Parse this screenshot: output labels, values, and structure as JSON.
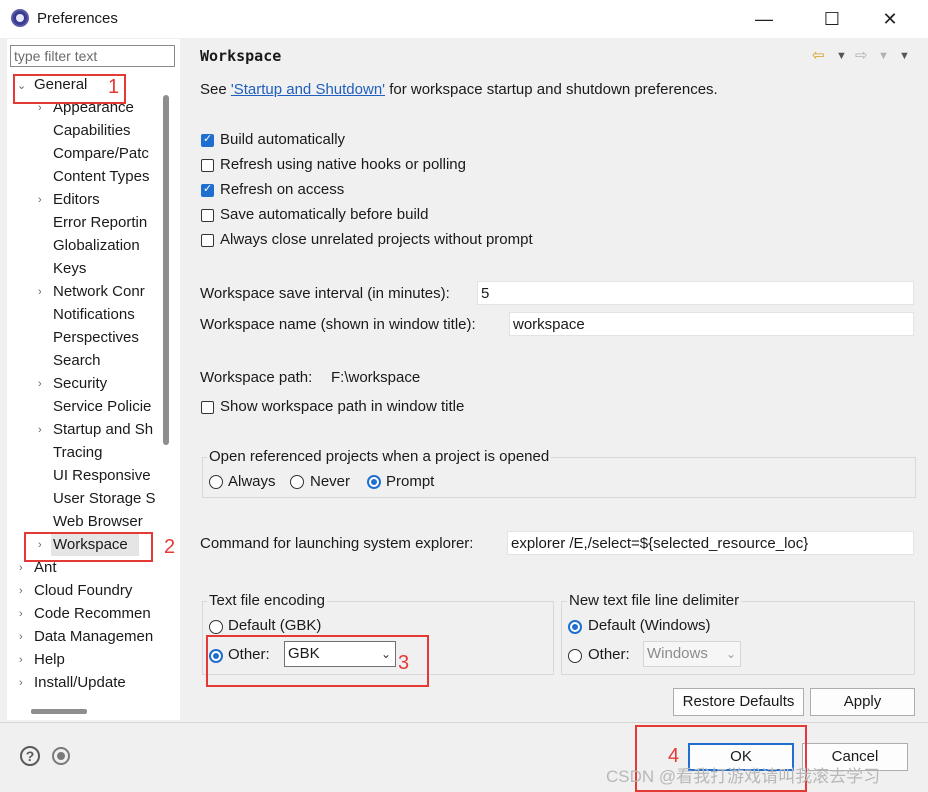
{
  "window": {
    "title": "Preferences",
    "buttons": {
      "minimize": "—",
      "maximize": "☐",
      "close": "✕"
    }
  },
  "filter": {
    "placeholder": "type filter text"
  },
  "tree": {
    "general": "General",
    "children": [
      "Appearance",
      "Capabilities",
      "Compare/Patc",
      "Content Types",
      "Editors",
      "Error Reportin",
      "Globalization",
      "Keys",
      "Network Conr",
      "Notifications",
      "Perspectives",
      "Search",
      "Security",
      "Service Policie",
      "Startup and Sh",
      "Tracing",
      "UI Responsive",
      "User Storage S",
      "Web Browser"
    ],
    "selected": "Workspace",
    "roots": [
      "Ant",
      "Cloud Foundry",
      "Code Recommen",
      "Data Managemen",
      "Help",
      "Install/Update"
    ]
  },
  "page": {
    "title": "Workspace",
    "intro_prefix": "See ",
    "intro_link": "'Startup and Shutdown'",
    "intro_suffix": " for workspace startup and shutdown preferences.",
    "checks": [
      {
        "label": "Build automatically",
        "checked": true
      },
      {
        "label": "Refresh using native hooks or polling",
        "checked": false
      },
      {
        "label": "Refresh on access",
        "checked": true
      },
      {
        "label": "Save automatically before build",
        "checked": false
      },
      {
        "label": "Always close unrelated projects without prompt",
        "checked": false
      }
    ],
    "save_interval_label": "Workspace save interval (in minutes):",
    "save_interval_value": "5",
    "name_label": "Workspace name (shown in window title):",
    "name_value": "workspace",
    "path_label": "Workspace path:",
    "path_value": "F:\\workspace",
    "show_path_label": "Show workspace path in window title",
    "open_ref_group": "Open referenced projects when a project is opened",
    "open_ref_options": [
      "Always",
      "Never",
      "Prompt"
    ],
    "open_ref_selected": "Prompt",
    "explorer_label": "Command for launching system explorer:",
    "explorer_value": "explorer /E,/select=${selected_resource_loc}",
    "encoding_group": "Text file encoding",
    "encoding_default": "Default (GBK)",
    "encoding_other": "Other:",
    "encoding_other_value": "GBK",
    "delim_group": "New text file line delimiter",
    "delim_default": "Default (Windows)",
    "delim_other": "Other:",
    "delim_other_value": "Windows",
    "restore_defaults": "Restore Defaults",
    "apply": "Apply"
  },
  "footer": {
    "ok": "OK",
    "cancel": "Cancel",
    "help_glyph": "?"
  },
  "annotations": [
    "1",
    "2",
    "3",
    "4"
  ],
  "watermark": "CSDN @看我打游戏请叫我滚去学习",
  "colors": {
    "accent": "#1f6fcf",
    "annotation": "#e53935",
    "link": "#1f5fbf"
  }
}
